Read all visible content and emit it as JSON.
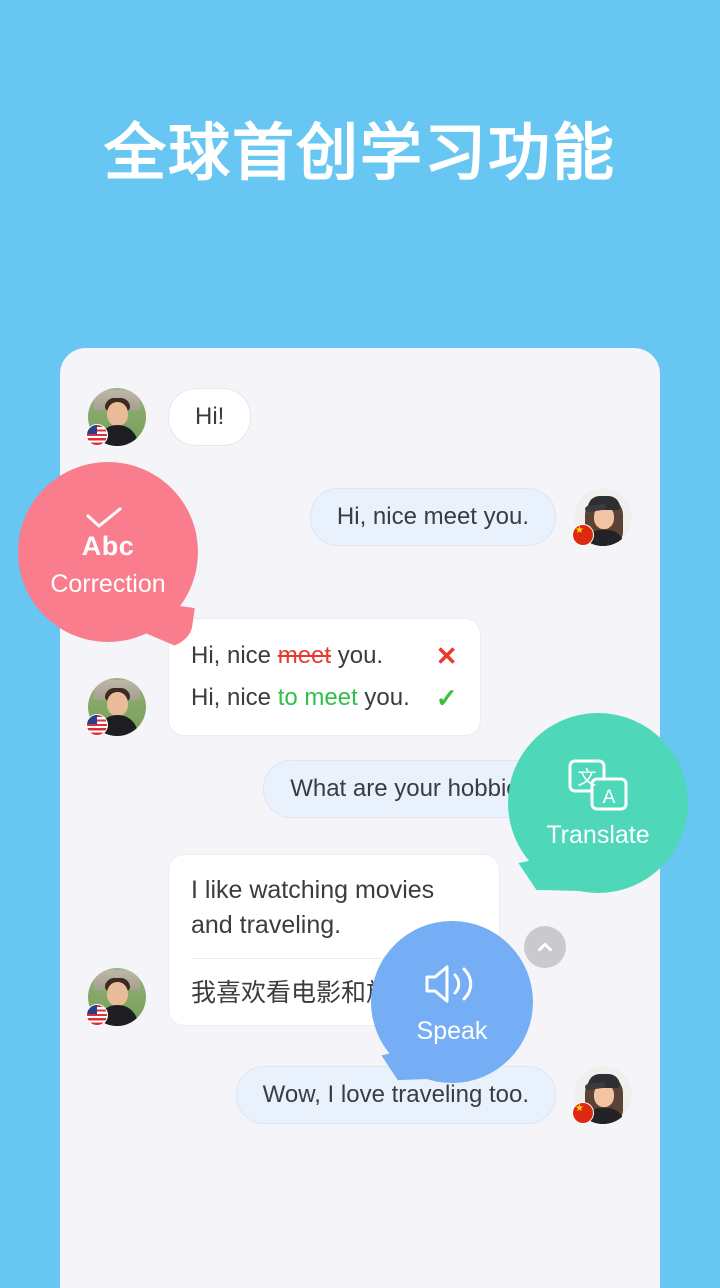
{
  "page": {
    "background_color": "#67c7f2",
    "headline": "全球首创学习功能"
  },
  "panel": {
    "background_color": "#f5f5f9"
  },
  "chat": {
    "messages": [
      {
        "id": "msg-hi",
        "side": "left",
        "text": "Hi!",
        "avatar": "male-us-avatar",
        "flag": "us-flag"
      },
      {
        "id": "msg-nice-meet-you",
        "side": "right",
        "text": "Hi, nice meet you.",
        "avatar": "female-cn-avatar",
        "flag": "cn-flag"
      },
      {
        "id": "msg-what-hobbies",
        "side": "right",
        "text": "What are your hobbies?"
      },
      {
        "id": "msg-wow-traveling",
        "side": "right",
        "text": "Wow, I love traveling too.",
        "avatar": "female-cn-avatar",
        "flag": "cn-flag"
      }
    ],
    "correction_card": {
      "original_prefix": "Hi, nice ",
      "original_error": "meet",
      "original_suffix": " you.",
      "wrong_mark": "✕",
      "corrected_prefix": "Hi, nice ",
      "corrected_fix": "to meet",
      "corrected_suffix": " you.",
      "right_mark": "✓",
      "error_color": "#e8392d",
      "fix_color": "#2fc04a"
    },
    "translate_card": {
      "source_text": "I like watching movies and traveling.",
      "translated_text": "我喜欢看电影和旅游。"
    }
  },
  "callouts": [
    {
      "id": "correction",
      "label": "Correction",
      "icon_label": "Abc",
      "icon": "check-abc-icon",
      "color": "#f97d8c"
    },
    {
      "id": "translate",
      "label": "Translate",
      "icon": "translate-icon",
      "color": "#4ed7b9"
    },
    {
      "id": "speak",
      "label": "Speak",
      "icon": "speaker-icon",
      "color": "#76aef5"
    }
  ],
  "controls": {
    "scroll_top": {
      "icon": "chevron-up-icon",
      "color": "#c9c9cf"
    }
  }
}
